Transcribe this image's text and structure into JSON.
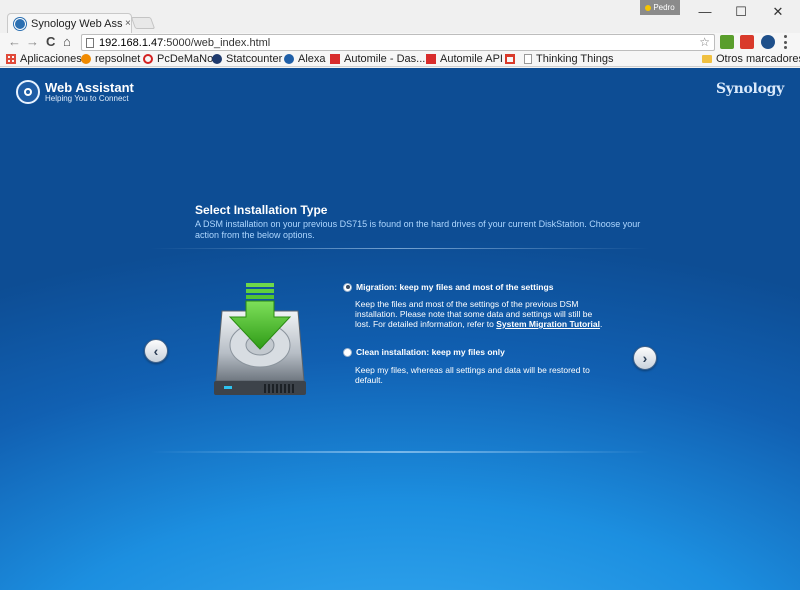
{
  "browser": {
    "tab_title": "Synology Web Assist",
    "tab_close": "×",
    "profile_name": "Pedro",
    "url_host": "192.168.1.47",
    "url_rest": ":5000/web_index.html",
    "window_controls": {
      "minimize": "—",
      "maximize": "☐",
      "close": "✕"
    },
    "nav": {
      "back": "←",
      "forward": "→",
      "reload": "C",
      "home": "⌂"
    },
    "star": "☆"
  },
  "bookmarks": [
    {
      "label": "Aplicaciones",
      "icon": "apps-grid-icon",
      "color": "#e04a3a"
    },
    {
      "label": "repsolnet",
      "icon": "repsol-icon",
      "color": "#f08a00"
    },
    {
      "label": "PcDeMaNo",
      "icon": "pcdemano-icon",
      "color": "#d32121"
    },
    {
      "label": "Statcounter",
      "icon": "statcounter-icon",
      "color": "#1e3a6e"
    },
    {
      "label": "Alexa",
      "icon": "alexa-icon",
      "color": "#1f5fa8"
    },
    {
      "label": "Automile - Das...",
      "icon": "automile-icon",
      "color": "#d82c2c"
    },
    {
      "label": "Automile API",
      "icon": "automile-icon",
      "color": "#d82c2c"
    },
    {
      "label": "Thinking Things",
      "icon": "page-icon",
      "color": "#ffffff"
    },
    {
      "label": "Otros marcadores",
      "icon": "folder-icon",
      "color": "#f0c040"
    }
  ],
  "header": {
    "app_name": "Web Assistant",
    "tagline": "Helping You to Connect",
    "brand": "Synology"
  },
  "main": {
    "title": "Select Installation Type",
    "description": "A DSM installation on your previous DS715 is found on the hard drives of your current DiskStation. Choose your action from the below options.",
    "options": [
      {
        "label": "Migration: keep my files and most of the settings",
        "selected": true,
        "desc_before": "Keep the files and most of the settings of the previous DSM installation. Please note that some data and settings will still be lost. For detailed information, refer to ",
        "link": "System Migration Tutorial",
        "desc_after": "."
      },
      {
        "label": "Clean installation: keep my files only",
        "selected": false,
        "desc_before": "Keep my files, whereas all settings and data will be restored to default."
      }
    ],
    "prev_arrow": "‹",
    "next_arrow": "›"
  },
  "colors": {
    "accent": "#1c8fe0",
    "hdd_arrow": "#3cb521"
  }
}
